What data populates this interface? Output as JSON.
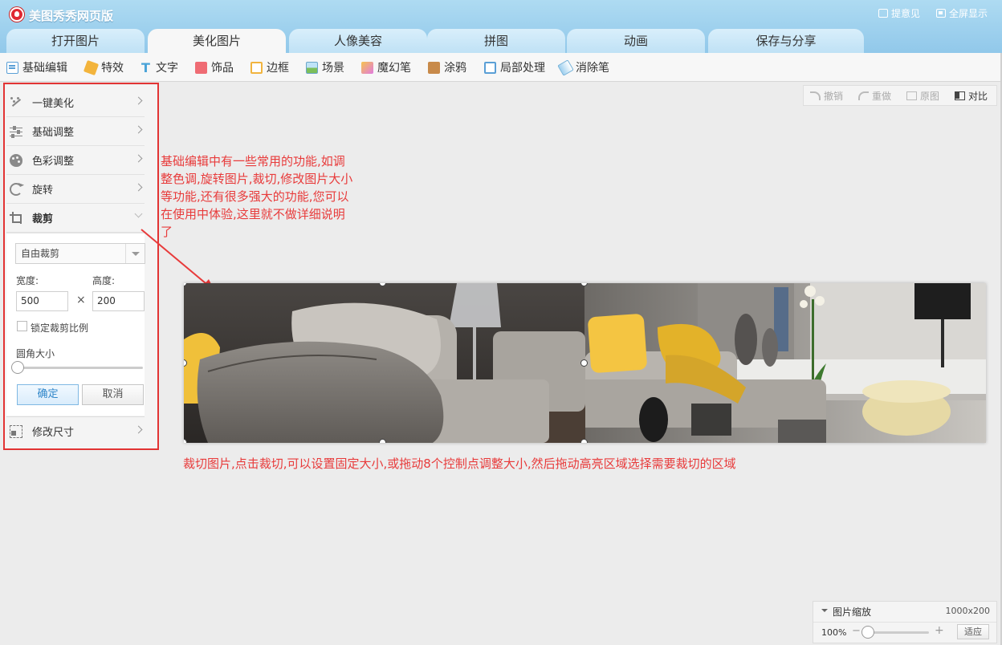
{
  "app": {
    "title": "美图秀秀网页版",
    "feedback_label": "提意见",
    "fullscreen_label": "全屏显示"
  },
  "tabs": [
    {
      "label": "打开图片",
      "active": false
    },
    {
      "label": "美化图片",
      "active": true
    },
    {
      "label": "人像美容",
      "active": false
    },
    {
      "label": "拼图",
      "active": false
    },
    {
      "label": "动画",
      "active": false
    },
    {
      "label": "保存与分享",
      "active": false
    }
  ],
  "toolbar": [
    {
      "label": "基础编辑",
      "icon": "basic-edit-icon"
    },
    {
      "label": "特效",
      "icon": "effects-icon"
    },
    {
      "label": "文字",
      "icon": "text-icon"
    },
    {
      "label": "饰品",
      "icon": "decoration-icon"
    },
    {
      "label": "边框",
      "icon": "frame-icon"
    },
    {
      "label": "场景",
      "icon": "scene-icon"
    },
    {
      "label": "魔幻笔",
      "icon": "magic-pen-icon"
    },
    {
      "label": "涂鸦",
      "icon": "doodle-icon"
    },
    {
      "label": "局部处理",
      "icon": "local-process-icon"
    },
    {
      "label": "消除笔",
      "icon": "eraser-pen-icon"
    }
  ],
  "panel": {
    "items": [
      {
        "label": "一键美化",
        "icon": "magic-wand-icon"
      },
      {
        "label": "基础调整",
        "icon": "sliders-icon"
      },
      {
        "label": "色彩调整",
        "icon": "palette-icon"
      },
      {
        "label": "旋转",
        "icon": "rotate-icon"
      },
      {
        "label": "裁剪",
        "icon": "crop-icon",
        "expanded": true
      },
      {
        "label": "修改尺寸",
        "icon": "resize-icon"
      }
    ],
    "crop": {
      "mode": "自由裁剪",
      "width_label": "宽度:",
      "height_label": "高度:",
      "width_value": "500",
      "height_value": "200",
      "times": "×",
      "lock_ratio_label": "锁定裁剪比例",
      "lock_ratio_checked": false,
      "corner_label": "圆角大小",
      "corner_value": 0,
      "confirm_label": "确定",
      "cancel_label": "取消"
    }
  },
  "canvas_tools": {
    "undo": "撤销",
    "redo": "重做",
    "original": "原图",
    "compare": "对比"
  },
  "annotations": {
    "basic_edit_note": "基础编辑中有一些常用的功能,如调整色调,旋转图片,裁切,修改图片大小等功能,还有很多强大的功能,您可以在使用中体验,这里就不做详细说明了",
    "crop_note": "裁切图片,点击裁切,可以设置固定大小,或拖动8个控制点调整大小,然后拖动高亮区域选择需要裁切的区域",
    "color": "#e83b3b"
  },
  "zoom": {
    "title": "图片缩放",
    "image_size": "1000x200",
    "percent": "100%",
    "minus": "−",
    "plus": "+",
    "fit_label": "适应",
    "level": 0
  }
}
